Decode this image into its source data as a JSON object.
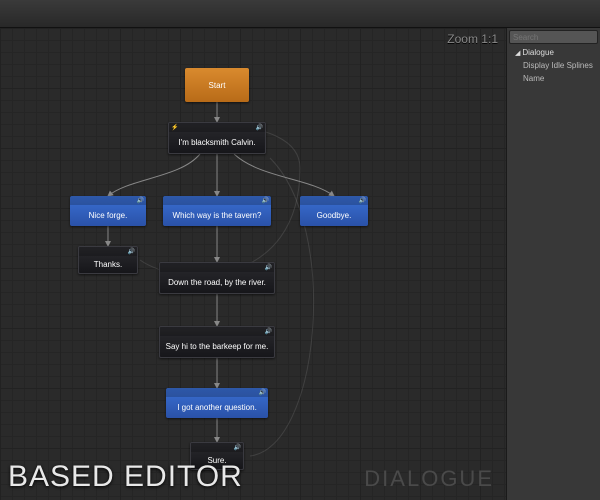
{
  "zoom_label": "Zoom 1:1",
  "search_placeholder": "Search",
  "tree": {
    "parent": "Dialogue",
    "children": [
      "Display Idle Splines",
      "Name"
    ]
  },
  "watermark_left": "BASED EDITOR",
  "watermark_right": "DIALOGUE",
  "icons": {
    "lightning": "⚡",
    "speaker": "🔊"
  },
  "nodes": {
    "start": {
      "label": "Start"
    },
    "npc1": {
      "label": "I'm blacksmith Calvin."
    },
    "choice1": {
      "label": "Nice forge."
    },
    "choice2": {
      "label": "Which way is the tavern?"
    },
    "choice3": {
      "label": "Goodbye."
    },
    "npc2": {
      "label": "Thanks."
    },
    "npc3": {
      "label": "Down the road, by the river."
    },
    "npc4": {
      "label": "Say hi to the barkeep for me."
    },
    "choice4": {
      "label": "I got another question."
    },
    "npc5": {
      "label": "Sure."
    }
  }
}
